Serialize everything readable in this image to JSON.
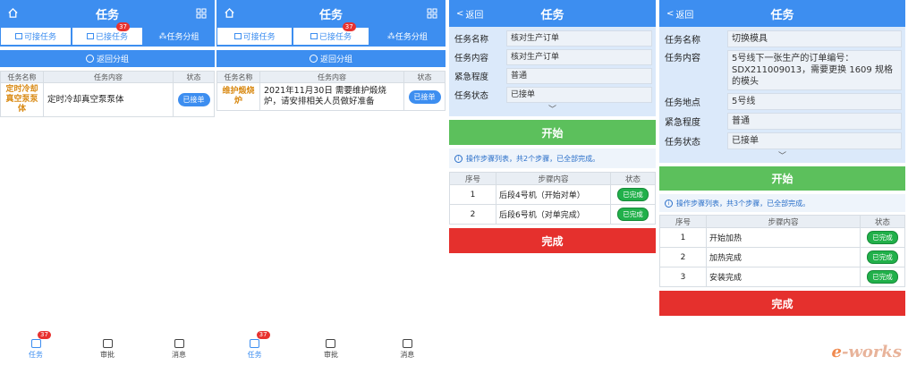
{
  "list_screen": {
    "title": "任务",
    "segments": [
      "可接任务",
      "已接任务",
      "任务分组"
    ],
    "active_segment": 2,
    "accepted_badge": "37",
    "return_group": "返回分组",
    "columns": [
      "任务名称",
      "任务内容",
      "状态"
    ],
    "tabbar": [
      {
        "label": "任务",
        "badge": "37"
      },
      {
        "label": "审批",
        "badge": ""
      },
      {
        "label": "消息",
        "badge": ""
      }
    ]
  },
  "panel1": {
    "rows": [
      {
        "name": "定时冷却真空泵泵体",
        "content": "定时冷却真空泵泵体",
        "status": "已接单"
      }
    ]
  },
  "panel2": {
    "rows": [
      {
        "name": "维护煅烧炉",
        "content": "2021年11月30日 需要维护煅烧炉，请安排相关人员做好准备",
        "status": "已接单"
      }
    ]
  },
  "panel3": {
    "back": "返回",
    "title": "任务",
    "fields": [
      {
        "label": "任务名称",
        "value": "核对生产订单"
      },
      {
        "label": "任务内容",
        "value": "核对生产订单"
      },
      {
        "label": "紧急程度",
        "value": "普通"
      },
      {
        "label": "任务状态",
        "value": "已接单"
      }
    ],
    "start_button": "开始",
    "tip": "操作步骤列表，共2个步骤，已全部完成。",
    "step_columns": [
      "序号",
      "步骤内容",
      "状态"
    ],
    "steps": [
      {
        "no": "1",
        "content": "后段4号机（开始对单）",
        "status": "已完成"
      },
      {
        "no": "2",
        "content": "后段6号机（对单完成）",
        "status": "已完成"
      }
    ],
    "done_button": "完成"
  },
  "panel4": {
    "back": "返回",
    "title": "任务",
    "fields": [
      {
        "label": "任务名称",
        "value": "切换模具"
      },
      {
        "label": "任务内容",
        "value": "5号线下一张生产的订单编号：SDX211009013，需要更换 1609 规格的模头"
      },
      {
        "label": "任务地点",
        "value": "5号线"
      },
      {
        "label": "紧急程度",
        "value": "普通"
      },
      {
        "label": "任务状态",
        "value": "已接单"
      }
    ],
    "start_button": "开始",
    "tip": "操作步骤列表，共3个步骤，已全部完成。",
    "step_columns": [
      "序号",
      "步骤内容",
      "状态"
    ],
    "steps": [
      {
        "no": "1",
        "content": "开始加热",
        "status": "已完成"
      },
      {
        "no": "2",
        "content": "加热完成",
        "status": "已完成"
      },
      {
        "no": "3",
        "content": "安装完成",
        "status": "已完成"
      }
    ],
    "done_button": "完成"
  },
  "watermark": {
    "prefix": "e",
    "text": "-works"
  },
  "colors": {
    "primary": "#3d8ef0",
    "success": "#21b04a",
    "start": "#5cc05c",
    "danger": "#e5302d",
    "task_name": "#d98a14"
  }
}
